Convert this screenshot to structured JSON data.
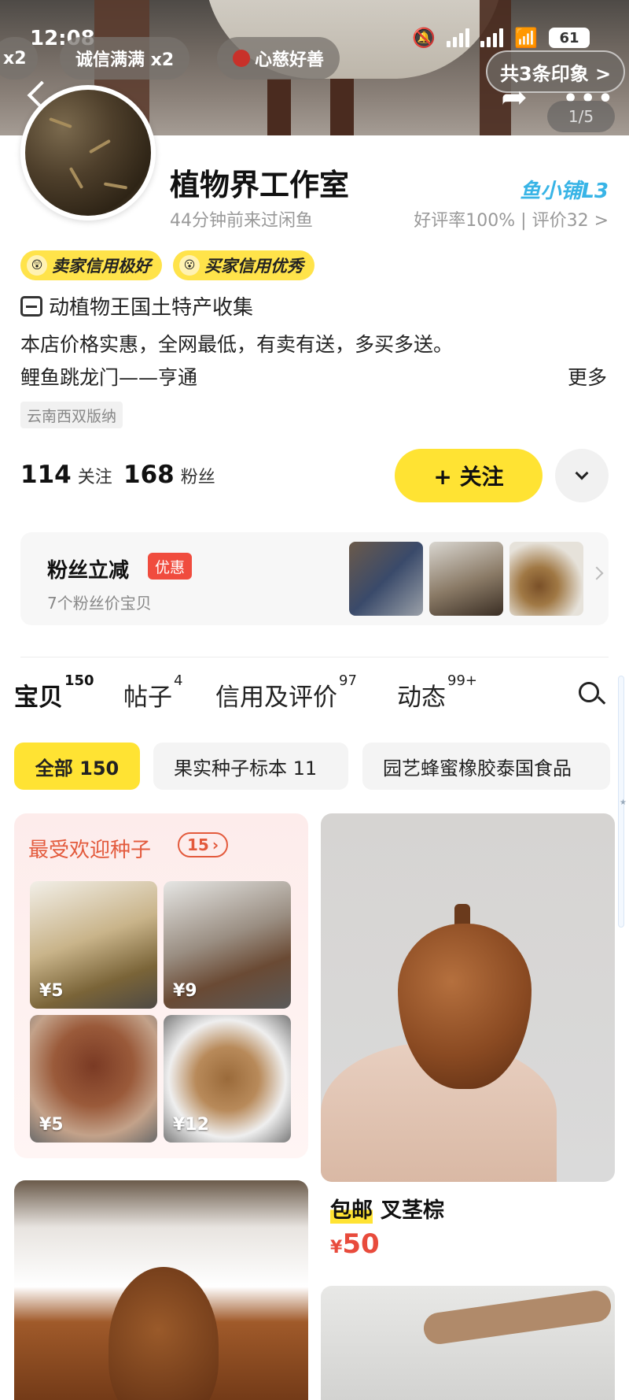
{
  "status_bar": {
    "time": "12:08",
    "battery": "61"
  },
  "header": {
    "chips": [
      "x2",
      "诚信满满 x2",
      "心慈好善"
    ],
    "impressions": "共3条印象 >",
    "page_indicator": "1/5"
  },
  "profile": {
    "shop_name": "植物界工作室",
    "last_visit": "44分钟前来过闲鱼",
    "shop_level": "鱼小铺L3",
    "rating": "好评率100% | 评价32 >",
    "seller_credit": "卖家信用极好",
    "buyer_credit": "买家信用优秀",
    "category": "动植物王国土特产收集",
    "desc_line1": "本店价格实惠，全网最低，有卖有送，多买多送。",
    "desc_line2": "鲤鱼跳龙门——亨通",
    "more": "更多",
    "location": "云南西双版纳",
    "following_count": "114",
    "following_label": "关注",
    "fans_count": "168",
    "fans_label": "粉丝",
    "follow_button": "+ 关注"
  },
  "fans_panel": {
    "title": "粉丝立减",
    "tag": "优惠",
    "subtitle": "7个粉丝价宝贝"
  },
  "tabs": [
    {
      "label": "宝贝",
      "count": "150"
    },
    {
      "label": "帖子",
      "count": "4"
    },
    {
      "label": "信用及评价",
      "count": "97"
    },
    {
      "label": "动态",
      "count": "99+"
    }
  ],
  "filters": [
    "全部 150",
    "果实种子标本 11",
    "园艺蜂蜜橡胶泰国食品"
  ],
  "promo": {
    "title": "最受欢迎种子",
    "count": "15",
    "items": [
      {
        "price": "¥5"
      },
      {
        "price": "¥9"
      },
      {
        "price": "¥5"
      },
      {
        "price": "¥12"
      }
    ]
  },
  "featured_item": {
    "free_shipping": "包邮",
    "name": "叉茎棕",
    "currency": "¥",
    "price": "50"
  },
  "colors": {
    "accent_yellow": "#ffe333",
    "price_red": "#e84b3c",
    "level_blue": "#38b4e6",
    "promo_red": "#e35a3c"
  }
}
